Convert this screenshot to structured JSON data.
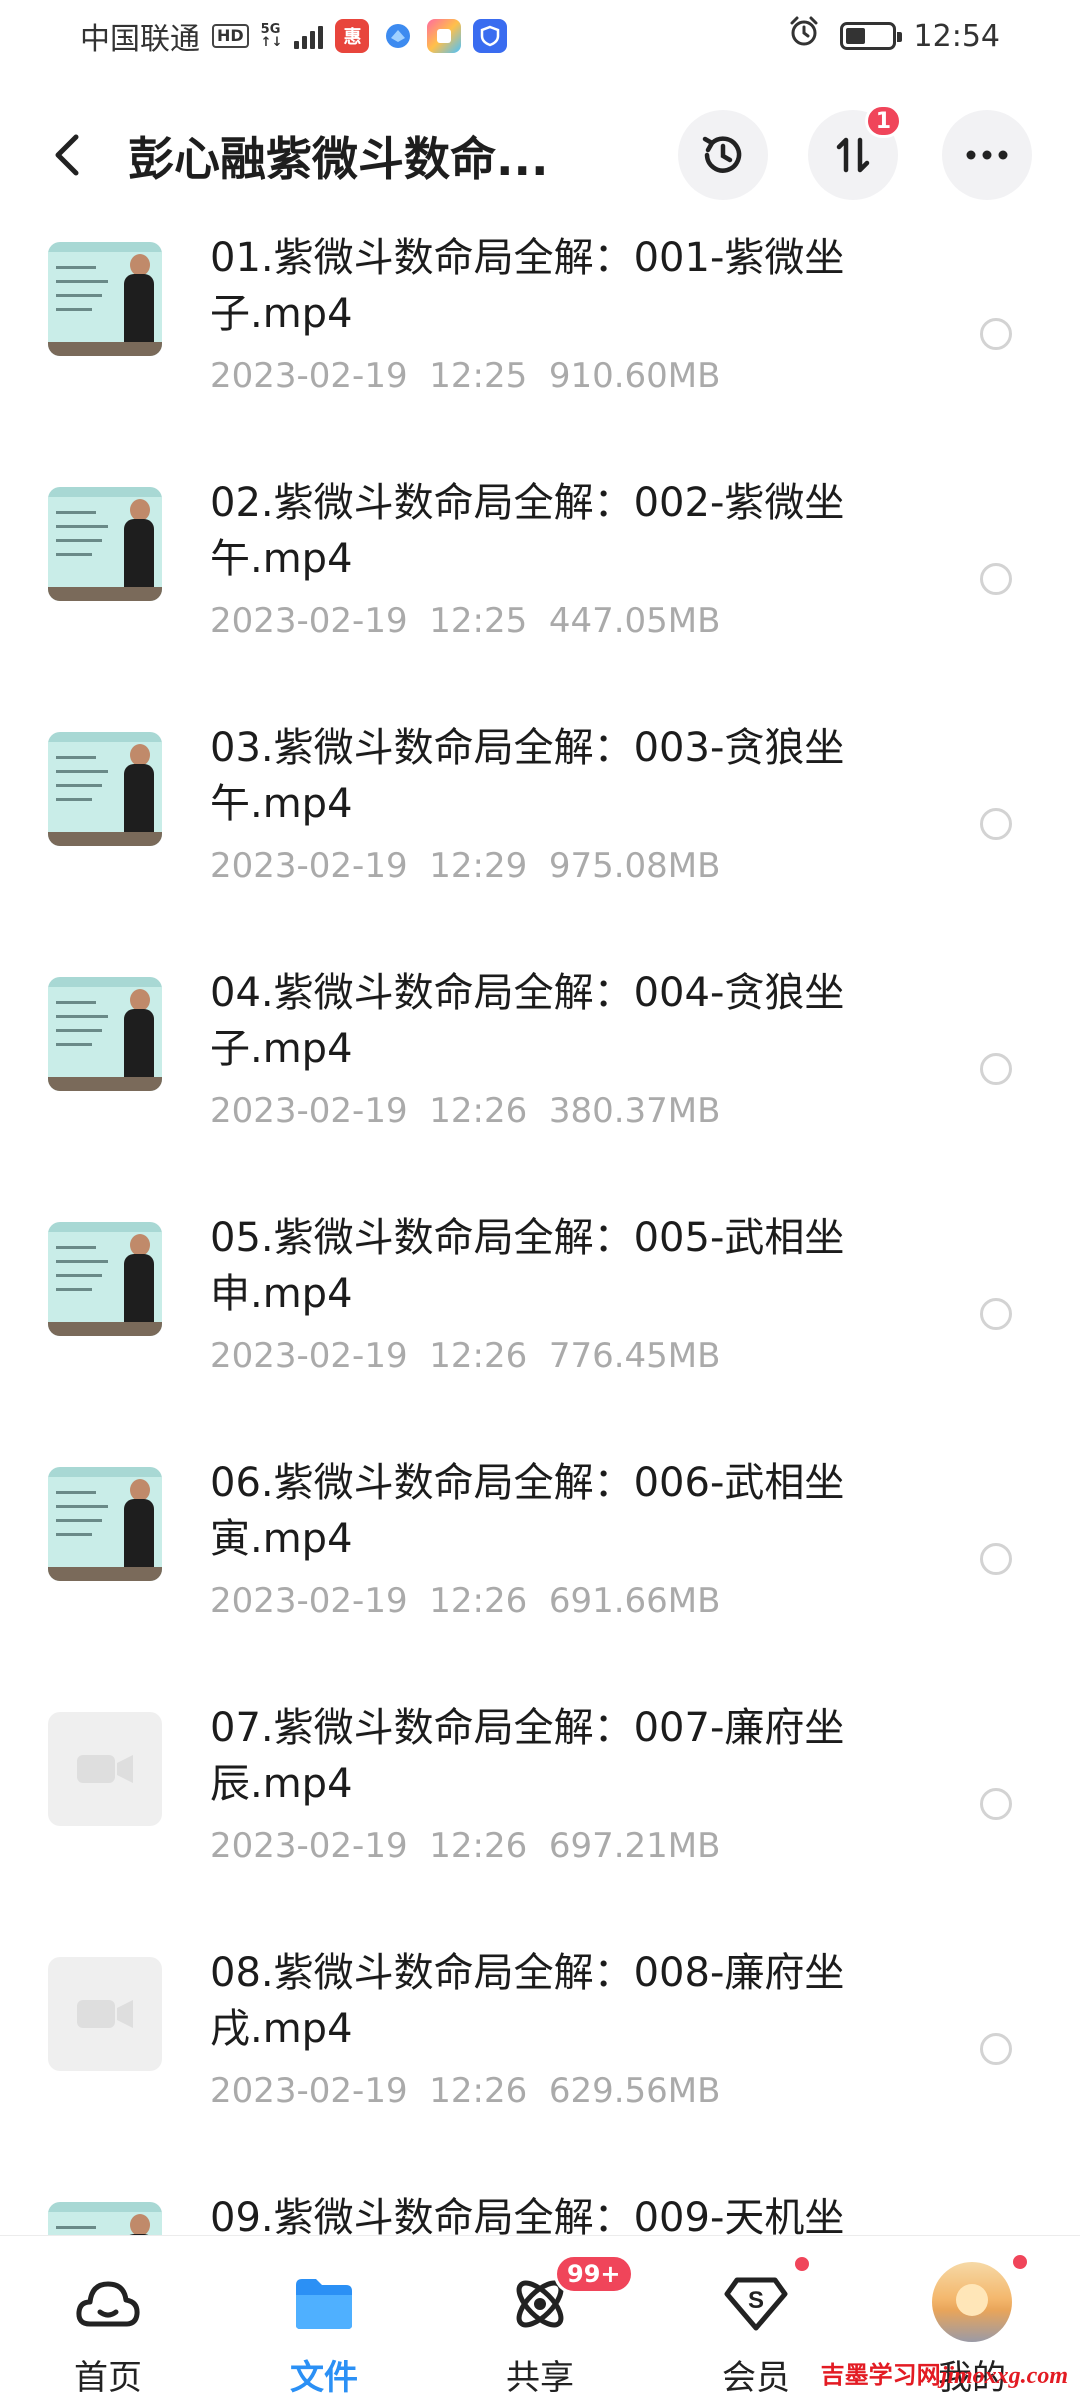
{
  "status_bar": {
    "carrier": "中国联通",
    "hd": "HD",
    "network": "5G",
    "time": "12:54",
    "battery_level": 0.45
  },
  "header": {
    "title": "彭心融紫微斗数命...",
    "transfer_badge": "1"
  },
  "files": [
    {
      "name": "01.紫微斗数命局全解：001-紫微坐子.mp4",
      "date": "2023-02-19",
      "time": "12:25",
      "size": "910.60MB",
      "thumb": "video"
    },
    {
      "name": "02.紫微斗数命局全解：002-紫微坐午.mp4",
      "date": "2023-02-19",
      "time": "12:25",
      "size": "447.05MB",
      "thumb": "video"
    },
    {
      "name": "03.紫微斗数命局全解：003-贪狼坐午.mp4",
      "date": "2023-02-19",
      "time": "12:29",
      "size": "975.08MB",
      "thumb": "video"
    },
    {
      "name": "04.紫微斗数命局全解：004-贪狼坐子.mp4",
      "date": "2023-02-19",
      "time": "12:26",
      "size": "380.37MB",
      "thumb": "video"
    },
    {
      "name": "05.紫微斗数命局全解：005-武相坐申.mp4",
      "date": "2023-02-19",
      "time": "12:26",
      "size": "776.45MB",
      "thumb": "video"
    },
    {
      "name": "06.紫微斗数命局全解：006-武相坐寅.mp4",
      "date": "2023-02-19",
      "time": "12:26",
      "size": "691.66MB",
      "thumb": "video"
    },
    {
      "name": "07.紫微斗数命局全解：007-廉府坐辰.mp4",
      "date": "2023-02-19",
      "time": "12:26",
      "size": "697.21MB",
      "thumb": "placeholder"
    },
    {
      "name": "08.紫微斗数命局全解：008-廉府坐戌.mp4",
      "date": "2023-02-19",
      "time": "12:26",
      "size": "629.56MB",
      "thumb": "placeholder"
    },
    {
      "name": "09.紫微斗数命局全解：009-天机坐",
      "date": "",
      "time": "",
      "size": "",
      "thumb": "video"
    }
  ],
  "bottom_nav": [
    {
      "label": "首页",
      "icon": "cloud-home-icon"
    },
    {
      "label": "文件",
      "icon": "folder-icon"
    },
    {
      "label": "共享",
      "icon": "share-orbit-icon",
      "badge": "99+"
    },
    {
      "label": "会员",
      "icon": "vip-diamond-icon"
    },
    {
      "label": "我的",
      "icon": "avatar"
    }
  ],
  "watermark": {
    "cn": "吉墨学习网",
    "en": "jimoxxg.com"
  },
  "colors": {
    "accent": "#2b90f5",
    "badge_red": "#f0455a",
    "meta_gray": "#aaaaaa"
  }
}
